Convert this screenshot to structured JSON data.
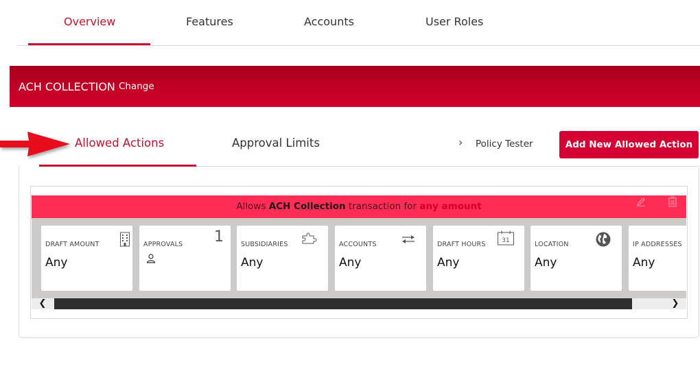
{
  "top_tabs": [
    {
      "label": "Overview",
      "active": true
    },
    {
      "label": "Features"
    },
    {
      "label": "Accounts"
    },
    {
      "label": "User Roles"
    }
  ],
  "banner": {
    "title": "ACH COLLECTION",
    "change_label": "Change"
  },
  "section_tabs": [
    {
      "label": "Allowed Actions",
      "active": true
    },
    {
      "label": "Approval Limits"
    }
  ],
  "policy_tester": {
    "icon": "chevron-right-icon",
    "label": "Policy Tester"
  },
  "add_button": {
    "label": "Add New Allowed Action"
  },
  "rule": {
    "prefix": "Allows",
    "transaction": "ACH Collection",
    "middle": "transaction for",
    "amount": "any amount"
  },
  "cards": [
    {
      "label": "DRAFT AMOUNT",
      "value": "Any",
      "icon": "building-icon"
    },
    {
      "label": "APPROVALS",
      "count": "1",
      "icon": "person-icon"
    },
    {
      "label": "SUBSIDIARIES",
      "value": "Any",
      "icon": "puzzle-icon"
    },
    {
      "label": "ACCOUNTS",
      "value": "Any",
      "icon": "transfer-arrows-icon"
    },
    {
      "label": "DRAFT HOURS",
      "value": "Any",
      "icon": "calendar-icon",
      "icon_text": "31"
    },
    {
      "label": "LOCATION",
      "value": "Any",
      "icon": "globe-icon"
    },
    {
      "label": "IP ADDRESSES",
      "value": "Any"
    }
  ],
  "scrollbar": {
    "left": "❮",
    "right": "❯"
  },
  "colors": {
    "accent": "#c8102e",
    "banner": "#b8001f",
    "button": "#d50032",
    "rule_strip": "#ff2d55"
  }
}
